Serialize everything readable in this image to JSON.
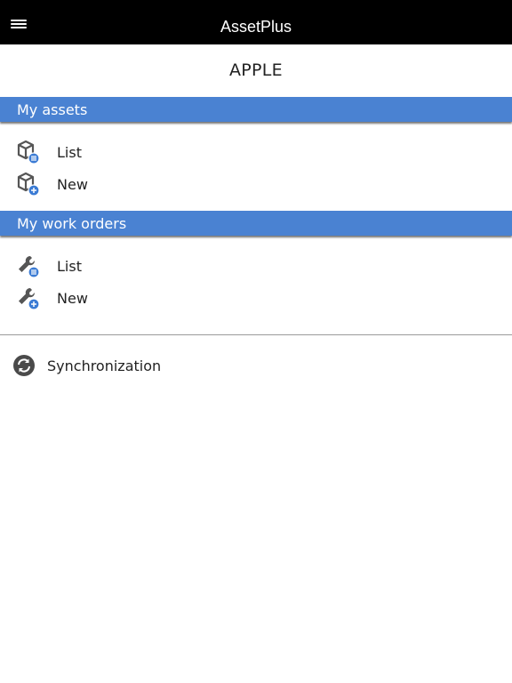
{
  "header": {
    "title": "AssetPlus",
    "menu_icon": "hamburger-icon"
  },
  "account": {
    "name": "APPLE"
  },
  "sections": {
    "assets": {
      "title": "My assets",
      "list_label": "List",
      "new_label": "New",
      "list_icon": "asset-list-icon",
      "new_icon": "asset-add-icon"
    },
    "work_orders": {
      "title": "My work orders",
      "list_label": "List",
      "new_label": "New",
      "list_icon": "wrench-list-icon",
      "new_icon": "wrench-add-icon"
    }
  },
  "sync": {
    "label": "Synchronization",
    "icon": "sync-icon"
  },
  "colors": {
    "topbar": "#000000",
    "section_header": "#4a82d2",
    "icon_gray": "#555555",
    "badge_blue": "#3b7bd4"
  }
}
